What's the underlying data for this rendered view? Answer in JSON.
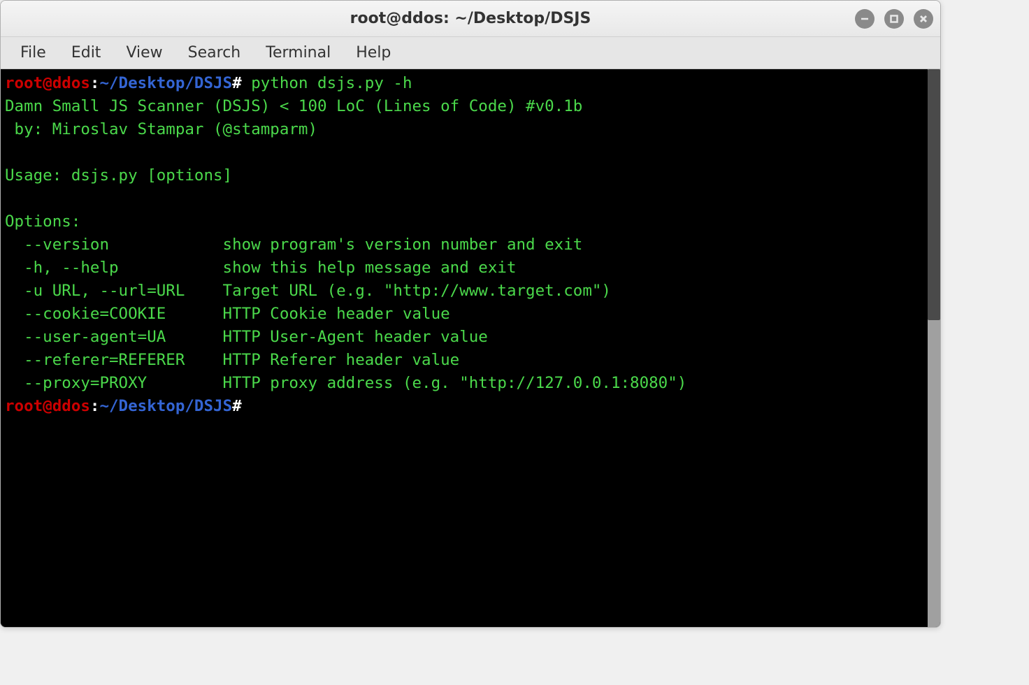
{
  "window": {
    "title": "root@ddos: ~/Desktop/DSJS"
  },
  "menu": {
    "file": "File",
    "edit": "Edit",
    "view": "View",
    "search": "Search",
    "terminal": "Terminal",
    "help": "Help"
  },
  "prompt": {
    "user_host": "root@ddos",
    "colon": ":",
    "path": "~/Desktop/DSJS",
    "symbol": "#"
  },
  "command": "python dsjs.py -h",
  "output": {
    "l1": "Damn Small JS Scanner (DSJS) < 100 LoC (Lines of Code) #v0.1b",
    "l2": " by: Miroslav Stampar (@stamparm)",
    "l3": "",
    "l4": "Usage: dsjs.py [options]",
    "l5": "",
    "l6": "Options:",
    "l7": "  --version            show program's version number and exit",
    "l8": "  -h, --help           show this help message and exit",
    "l9": "  -u URL, --url=URL    Target URL (e.g. \"http://www.target.com\")",
    "l10": "  --cookie=COOKIE      HTTP Cookie header value",
    "l11": "  --user-agent=UA      HTTP User-Agent header value",
    "l12": "  --referer=REFERER    HTTP Referer header value",
    "l13": "  --proxy=PROXY        HTTP proxy address (e.g. \"http://127.0.0.1:8080\")"
  }
}
